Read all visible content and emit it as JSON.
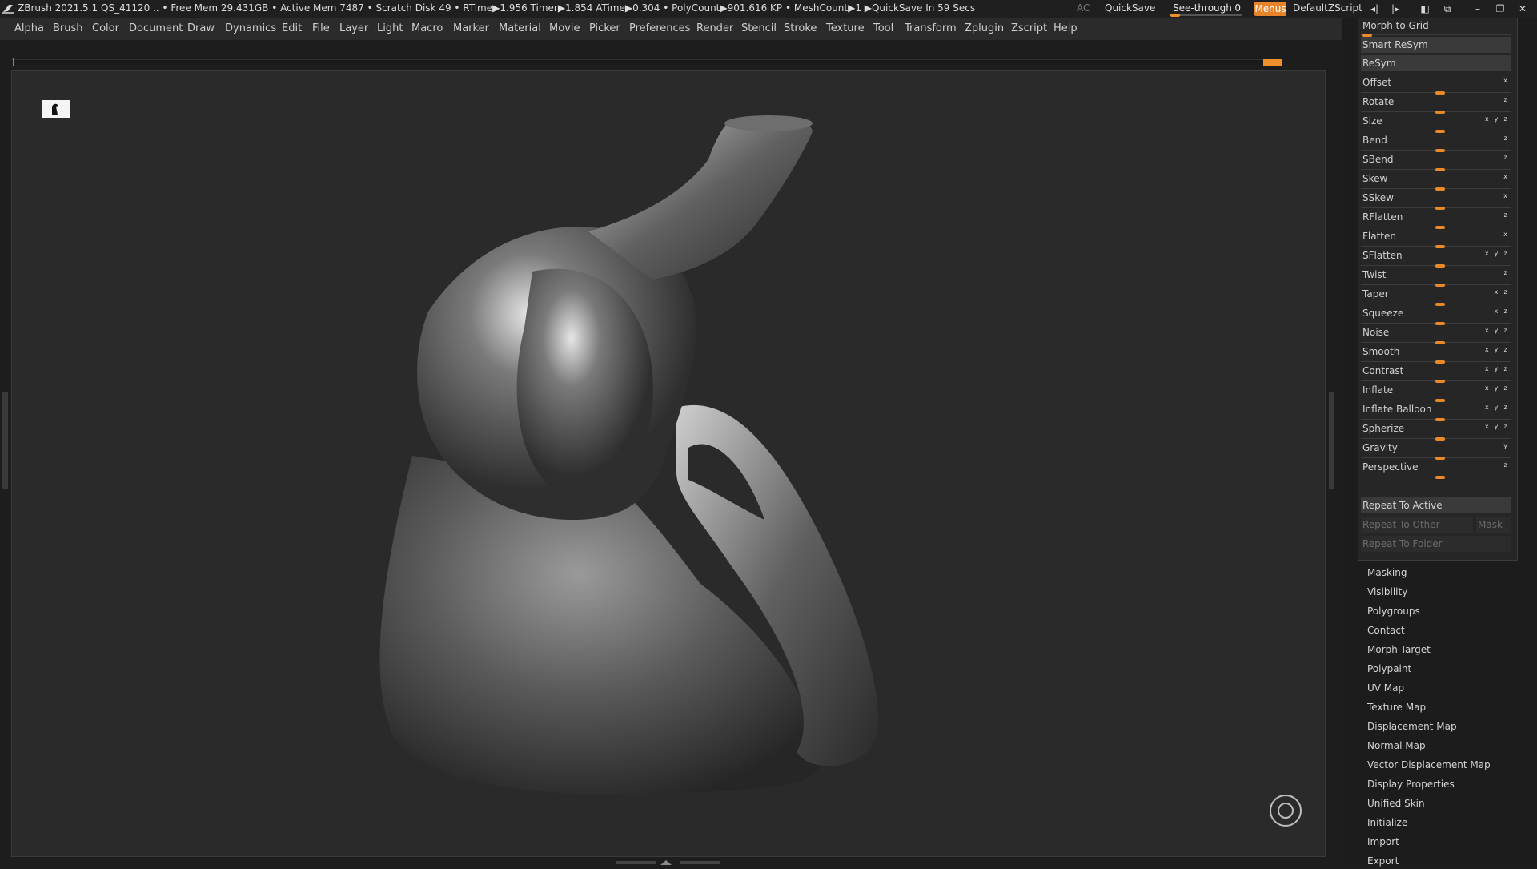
{
  "titlebar": {
    "app": "ZBrush 2021.5.1",
    "qs": "QS_41120",
    "stats": ".. • Free Mem 29.431GB • Active Mem 7487 • Scratch Disk 49 •  RTime▶1.956 Timer▶1.854 ATime▶0.304 • PolyCount▶901.616 KP  • MeshCount▶1  ▶QuickSave In 59 Secs",
    "ac": "AC",
    "quicksave": "QuickSave",
    "see_through_label": "See-through",
    "see_through_value": "0",
    "menus": "Menus",
    "zscript": "DefaultZScript"
  },
  "menubar": [
    "Alpha",
    "Brush",
    "Color",
    "Document",
    "Draw",
    "Dynamics",
    "Edit",
    "File",
    "Layer",
    "Light",
    "Macro",
    "Marker",
    "Material",
    "Movie",
    "Picker",
    "Preferences",
    "Render",
    "Stencil",
    "Stroke",
    "Texture",
    "Tool",
    "Transform",
    "Zplugin",
    "Zscript",
    "Help"
  ],
  "deformation": {
    "morph_to_grid": "Morph to Grid",
    "smart_resym": "Smart ReSym",
    "resym": "ReSym",
    "sliders": [
      {
        "name": "Offset",
        "axes": "x"
      },
      {
        "name": "Rotate",
        "axes": "z"
      },
      {
        "name": "Size",
        "axes": "x y z"
      },
      {
        "name": "Bend",
        "axes": "z"
      },
      {
        "name": "SBend",
        "axes": "z"
      },
      {
        "name": "Skew",
        "axes": "x"
      },
      {
        "name": "SSkew",
        "axes": "x"
      },
      {
        "name": "RFlatten",
        "axes": "z"
      },
      {
        "name": "Flatten",
        "axes": "x"
      },
      {
        "name": "SFlatten",
        "axes": "x y z"
      },
      {
        "name": "Twist",
        "axes": "z"
      },
      {
        "name": "Taper",
        "axes": "x z"
      },
      {
        "name": "Squeeze",
        "axes": "x z"
      },
      {
        "name": "Noise",
        "axes": "x y z"
      },
      {
        "name": "Smooth",
        "axes": "x y z"
      },
      {
        "name": "Contrast",
        "axes": "x y z"
      },
      {
        "name": "Inflate",
        "axes": "x y z"
      },
      {
        "name": "Inflate Balloon",
        "axes": "x y z"
      },
      {
        "name": "Spherize",
        "axes": "x y z"
      },
      {
        "name": "Gravity",
        "axes": "y"
      },
      {
        "name": "Perspective",
        "axes": "z"
      }
    ],
    "repeat_to_active": "Repeat To Active",
    "repeat_to_other": "Repeat To Other",
    "mask": "Mask",
    "repeat_to_folder": "Repeat To Folder"
  },
  "subpalettes": [
    "Masking",
    "Visibility",
    "Polygroups",
    "Contact",
    "Morph Target",
    "Polypaint",
    "UV Map",
    "Texture Map",
    "Displacement Map",
    "Normal Map",
    "Vector Displacement Map",
    "Display Properties",
    "Unified Skin",
    "Initialize",
    "Import",
    "Export"
  ],
  "colors": {
    "accent": "#e8892a",
    "bg": "#2a2a2a"
  }
}
